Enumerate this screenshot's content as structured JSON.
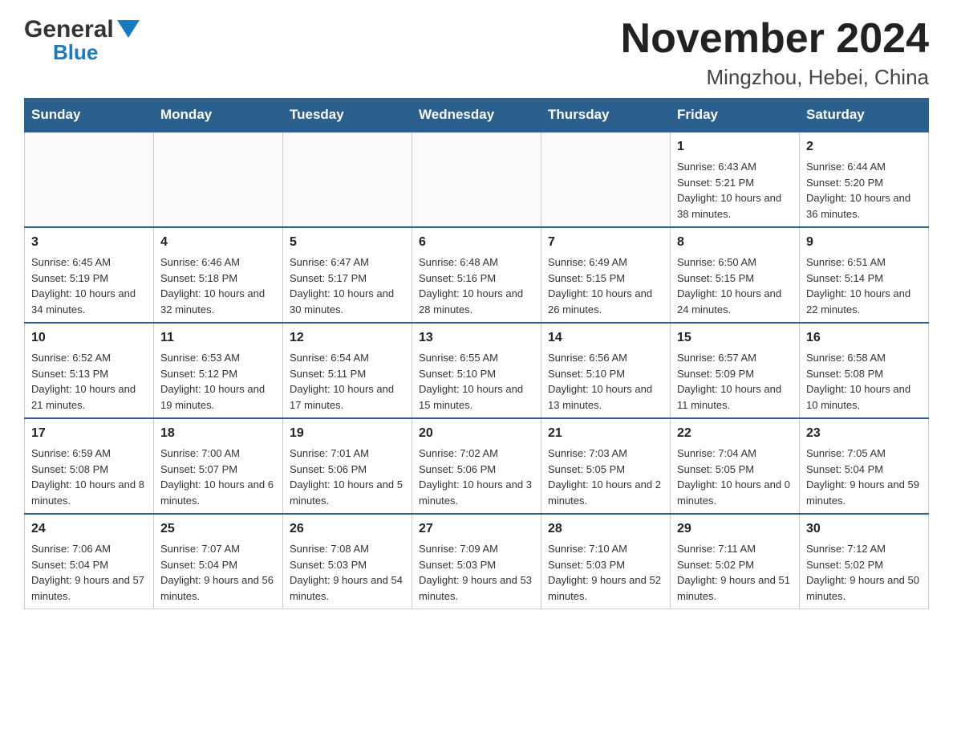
{
  "header": {
    "logo_general": "General",
    "logo_blue": "Blue",
    "title": "November 2024",
    "subtitle": "Mingzhou, Hebei, China"
  },
  "weekdays": [
    "Sunday",
    "Monday",
    "Tuesday",
    "Wednesday",
    "Thursday",
    "Friday",
    "Saturday"
  ],
  "weeks": [
    [
      {
        "day": "",
        "info": ""
      },
      {
        "day": "",
        "info": ""
      },
      {
        "day": "",
        "info": ""
      },
      {
        "day": "",
        "info": ""
      },
      {
        "day": "",
        "info": ""
      },
      {
        "day": "1",
        "info": "Sunrise: 6:43 AM\nSunset: 5:21 PM\nDaylight: 10 hours and 38 minutes."
      },
      {
        "day": "2",
        "info": "Sunrise: 6:44 AM\nSunset: 5:20 PM\nDaylight: 10 hours and 36 minutes."
      }
    ],
    [
      {
        "day": "3",
        "info": "Sunrise: 6:45 AM\nSunset: 5:19 PM\nDaylight: 10 hours and 34 minutes."
      },
      {
        "day": "4",
        "info": "Sunrise: 6:46 AM\nSunset: 5:18 PM\nDaylight: 10 hours and 32 minutes."
      },
      {
        "day": "5",
        "info": "Sunrise: 6:47 AM\nSunset: 5:17 PM\nDaylight: 10 hours and 30 minutes."
      },
      {
        "day": "6",
        "info": "Sunrise: 6:48 AM\nSunset: 5:16 PM\nDaylight: 10 hours and 28 minutes."
      },
      {
        "day": "7",
        "info": "Sunrise: 6:49 AM\nSunset: 5:15 PM\nDaylight: 10 hours and 26 minutes."
      },
      {
        "day": "8",
        "info": "Sunrise: 6:50 AM\nSunset: 5:15 PM\nDaylight: 10 hours and 24 minutes."
      },
      {
        "day": "9",
        "info": "Sunrise: 6:51 AM\nSunset: 5:14 PM\nDaylight: 10 hours and 22 minutes."
      }
    ],
    [
      {
        "day": "10",
        "info": "Sunrise: 6:52 AM\nSunset: 5:13 PM\nDaylight: 10 hours and 21 minutes."
      },
      {
        "day": "11",
        "info": "Sunrise: 6:53 AM\nSunset: 5:12 PM\nDaylight: 10 hours and 19 minutes."
      },
      {
        "day": "12",
        "info": "Sunrise: 6:54 AM\nSunset: 5:11 PM\nDaylight: 10 hours and 17 minutes."
      },
      {
        "day": "13",
        "info": "Sunrise: 6:55 AM\nSunset: 5:10 PM\nDaylight: 10 hours and 15 minutes."
      },
      {
        "day": "14",
        "info": "Sunrise: 6:56 AM\nSunset: 5:10 PM\nDaylight: 10 hours and 13 minutes."
      },
      {
        "day": "15",
        "info": "Sunrise: 6:57 AM\nSunset: 5:09 PM\nDaylight: 10 hours and 11 minutes."
      },
      {
        "day": "16",
        "info": "Sunrise: 6:58 AM\nSunset: 5:08 PM\nDaylight: 10 hours and 10 minutes."
      }
    ],
    [
      {
        "day": "17",
        "info": "Sunrise: 6:59 AM\nSunset: 5:08 PM\nDaylight: 10 hours and 8 minutes."
      },
      {
        "day": "18",
        "info": "Sunrise: 7:00 AM\nSunset: 5:07 PM\nDaylight: 10 hours and 6 minutes."
      },
      {
        "day": "19",
        "info": "Sunrise: 7:01 AM\nSunset: 5:06 PM\nDaylight: 10 hours and 5 minutes."
      },
      {
        "day": "20",
        "info": "Sunrise: 7:02 AM\nSunset: 5:06 PM\nDaylight: 10 hours and 3 minutes."
      },
      {
        "day": "21",
        "info": "Sunrise: 7:03 AM\nSunset: 5:05 PM\nDaylight: 10 hours and 2 minutes."
      },
      {
        "day": "22",
        "info": "Sunrise: 7:04 AM\nSunset: 5:05 PM\nDaylight: 10 hours and 0 minutes."
      },
      {
        "day": "23",
        "info": "Sunrise: 7:05 AM\nSunset: 5:04 PM\nDaylight: 9 hours and 59 minutes."
      }
    ],
    [
      {
        "day": "24",
        "info": "Sunrise: 7:06 AM\nSunset: 5:04 PM\nDaylight: 9 hours and 57 minutes."
      },
      {
        "day": "25",
        "info": "Sunrise: 7:07 AM\nSunset: 5:04 PM\nDaylight: 9 hours and 56 minutes."
      },
      {
        "day": "26",
        "info": "Sunrise: 7:08 AM\nSunset: 5:03 PM\nDaylight: 9 hours and 54 minutes."
      },
      {
        "day": "27",
        "info": "Sunrise: 7:09 AM\nSunset: 5:03 PM\nDaylight: 9 hours and 53 minutes."
      },
      {
        "day": "28",
        "info": "Sunrise: 7:10 AM\nSunset: 5:03 PM\nDaylight: 9 hours and 52 minutes."
      },
      {
        "day": "29",
        "info": "Sunrise: 7:11 AM\nSunset: 5:02 PM\nDaylight: 9 hours and 51 minutes."
      },
      {
        "day": "30",
        "info": "Sunrise: 7:12 AM\nSunset: 5:02 PM\nDaylight: 9 hours and 50 minutes."
      }
    ]
  ]
}
